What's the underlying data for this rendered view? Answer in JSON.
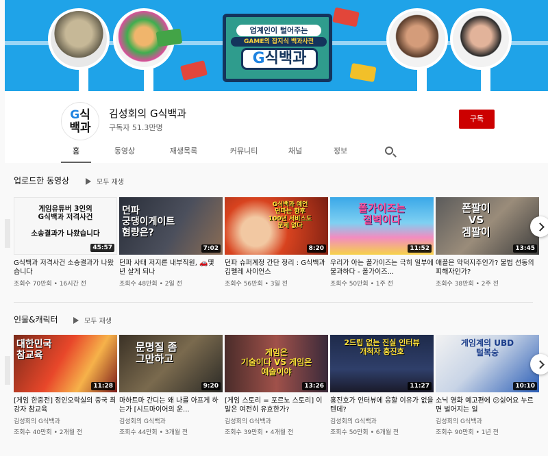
{
  "banner": {
    "tagline": "업계인이 털어주는",
    "subtitle": "GAME의 잡지식 백과사전",
    "logo_g": "G",
    "logo_rest": "식백과"
  },
  "channel": {
    "avatar_g": "G",
    "avatar_line1": "식",
    "avatar_line2": "백과",
    "name": "김성회의 G식백과",
    "subscribers": "구독자 51.3만명",
    "subscribe_label": "구독"
  },
  "tabs": [
    {
      "label": "홈"
    },
    {
      "label": "동영상"
    },
    {
      "label": "재생목록"
    },
    {
      "label": "커뮤니티"
    },
    {
      "label": "채널"
    },
    {
      "label": "정보"
    }
  ],
  "shelves": [
    {
      "title": "업로드한 동영상",
      "play_all": "모두 재생",
      "videos": [
        {
          "thumb_text": "게임유튜버 3인의\nG식백과 저격사건\n\n소송결과가 나왔습니다",
          "duration": "45:57",
          "title": "G식백과 저격사건 소송결과가 나왔습니다",
          "channel": "",
          "meta": "조회수 70만회 • 16시간 전"
        },
        {
          "thumb_text": "던파\n궁댕이게이트\n혐량은?",
          "duration": "7:02",
          "title": "던파 사태 저지른 내부직원, 🚗몇 년 살게 되나",
          "channel": "",
          "meta": "조회수 48만회 • 2일 전"
        },
        {
          "thumb_text": "G식백과 예언\n던파는 향후\n100년 서비스도\n문제 없다",
          "duration": "8:20",
          "title": "던파 슈퍼계정 간단 정리 : G식백과 김펠레 사이언스",
          "channel": "",
          "meta": "조회수 56만회 • 3일 전"
        },
        {
          "thumb_text": "폴가이즈는\n절벽이다",
          "duration": "11:52",
          "title": "우리가 아는 폴가이즈는 극히 일부에 불과하다 - 폴가이즈...",
          "channel": "",
          "meta": "조회수 50만회 • 1주 전"
        },
        {
          "thumb_text": "폰팔이\nVS\n겜팔이",
          "duration": "13:45",
          "title": "애플은 악덕지주인가? 불법 선동의 피해자인가?",
          "channel": "",
          "meta": "조회수 38만회 • 2주 전"
        }
      ]
    },
    {
      "title": "인물&캐릭터",
      "play_all": "모두 재생",
      "videos": [
        {
          "thumb_text": "대한민국\n참교육",
          "duration": "11:28",
          "title": "[게임 한중전] 정인오락실의 중국 최강자 참교육",
          "channel": "김성회의 G식백과",
          "meta": "조회수 40만회 • 2개월 전"
        },
        {
          "thumb_text": "문명질 좀\n그만하고",
          "duration": "9:20",
          "title": "마하트마 간디는 왜 나를 아프게 하는가 [시드마이어의 운...",
          "channel": "김성회의 G식백과",
          "meta": "조회수 44만회 • 3개월 전"
        },
        {
          "thumb_text": "게임은\n기술이다 VS 게임은\n예술이야",
          "duration": "13:26",
          "title": "[게임 스토리 = 포르노 스토리] 이 말은 여전히 유효한가?",
          "channel": "김성회의 G식백과",
          "meta": "조회수 39만회 • 4개월 전"
        },
        {
          "thumb_text": "2드립 없는 진실 인터뷰\n개척자 홍진호",
          "duration": "11:27",
          "title": "홍진호가 인터뷰에 응할 이유가 없을텐데?",
          "channel": "김성회의 G식백과",
          "meta": "조회수 50만회 • 6개월 전"
        },
        {
          "thumb_text": "게임계의 UBD\n털복숭",
          "duration": "10:10",
          "title": "소닉 영화 예고편에 😕싫어요 누르면 벌어지는 일",
          "channel": "김성회의 G식백과",
          "meta": "조회수 90만회 • 1년 전"
        }
      ]
    }
  ]
}
